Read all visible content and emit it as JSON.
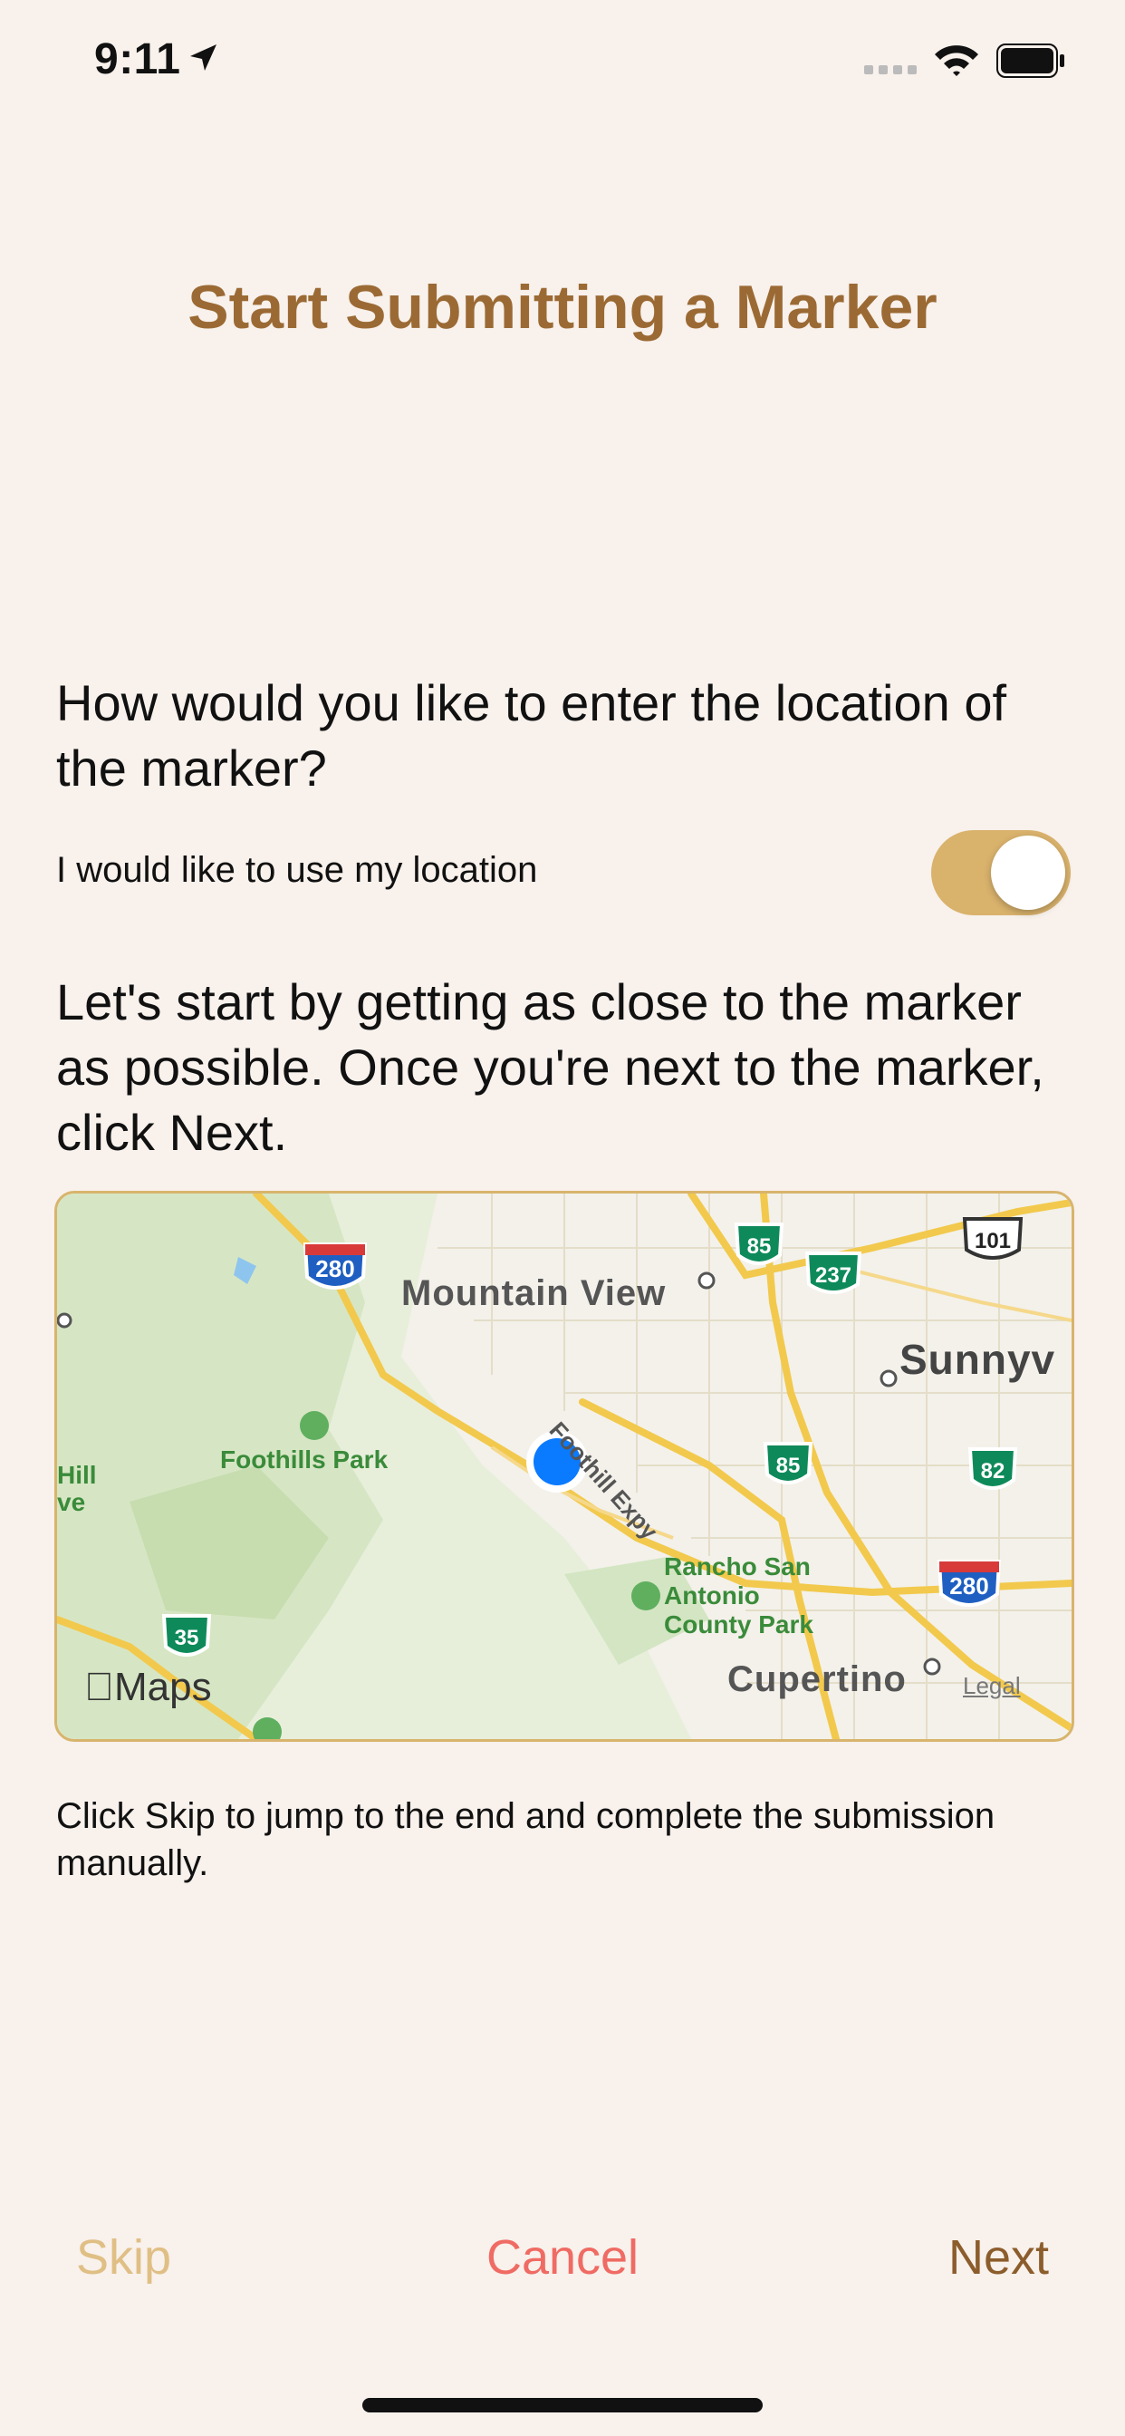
{
  "status": {
    "time": "9:11"
  },
  "title": "Start Submitting a Marker",
  "question": "How would you like to enter the location of the marker?",
  "toggle": {
    "label": "I would like to use my location",
    "on": true,
    "color": "#d9b26c"
  },
  "instructions": "Let's start by getting as close to the marker as possible. Once you're next to the marker, click Next.",
  "map": {
    "labels": {
      "mountain_view": "Mountain View",
      "sunnyvale": "Sunnyv",
      "foothills_park": "Foothills Park",
      "rancho": "Rancho San Antonio County Park",
      "cupertino": "Cupertino",
      "foothill_expy": "Foothill Expy",
      "hill": "Hill ve",
      "legal": "Legal",
      "maps": "Maps"
    },
    "shields": [
      "280",
      "85",
      "237",
      "101",
      "85",
      "82",
      "280",
      "35"
    ]
  },
  "note": "Click Skip to jump to the end and complete the submission manually.",
  "buttons": {
    "skip": "Skip",
    "cancel": "Cancel",
    "next": "Next"
  },
  "colors": {
    "title": "#9b6a34",
    "cancel": "#ef6b63",
    "skip": "#e0bf85",
    "next": "#8c5d2c",
    "background": "#f8f1ec"
  }
}
